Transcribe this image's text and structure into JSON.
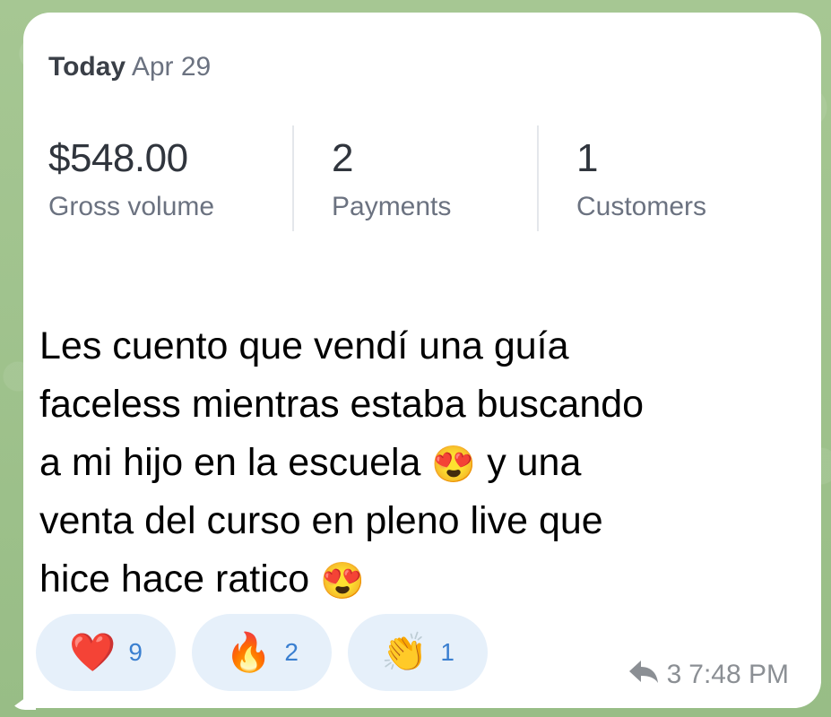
{
  "dashboard": {
    "date_prefix": "Today",
    "date": "Apr 29",
    "metrics": [
      {
        "value": "$548.00",
        "label": "Gross volume"
      },
      {
        "value": "2",
        "label": "Payments"
      },
      {
        "value": "1",
        "label": "Customers"
      }
    ]
  },
  "message": {
    "lines": [
      "Les cuento que vendí una guía",
      "faceless mientras estaba buscando",
      "a mi hijo en la escuela",
      "y una",
      "venta del curso en pleno live que",
      "hice hace ratico"
    ],
    "emoji_inline_1": "😍",
    "emoji_inline_2": "😍"
  },
  "reactions": [
    {
      "emoji": "❤️",
      "count": "9",
      "icon": "heart-icon"
    },
    {
      "emoji": "🔥",
      "count": "2",
      "icon": "fire-icon"
    },
    {
      "emoji": "👏",
      "count": "1",
      "icon": "clap-icon"
    }
  ],
  "meta": {
    "forwards": "3",
    "time": "7:48 PM"
  },
  "colors": {
    "wallpaper": "#9cc08a",
    "bubble": "#ffffff",
    "reaction_bg": "#e6f0fa",
    "reaction_count": "#3a7fd0",
    "meta": "#8b8f94"
  }
}
